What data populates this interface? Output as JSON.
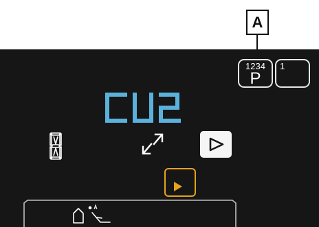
{
  "callout": {
    "label": "A"
  },
  "program_buttons": [
    {
      "top_label": "1234",
      "main_label": "P"
    },
    {
      "top_label": "1",
      "main_label": ""
    }
  ],
  "display": {
    "code": "CU2"
  },
  "icons": {
    "segment_digit": "segment-digit-icon",
    "expand": "expand-arrows-icon",
    "play": "play-triangle-icon",
    "enter": "enter-play-icon",
    "mode": "house-person-icon"
  },
  "colors": {
    "panel": "#161616",
    "code_blue": "#5ab2dc",
    "accent_orange": "#e8a21c",
    "icon_white": "#ffffff"
  }
}
